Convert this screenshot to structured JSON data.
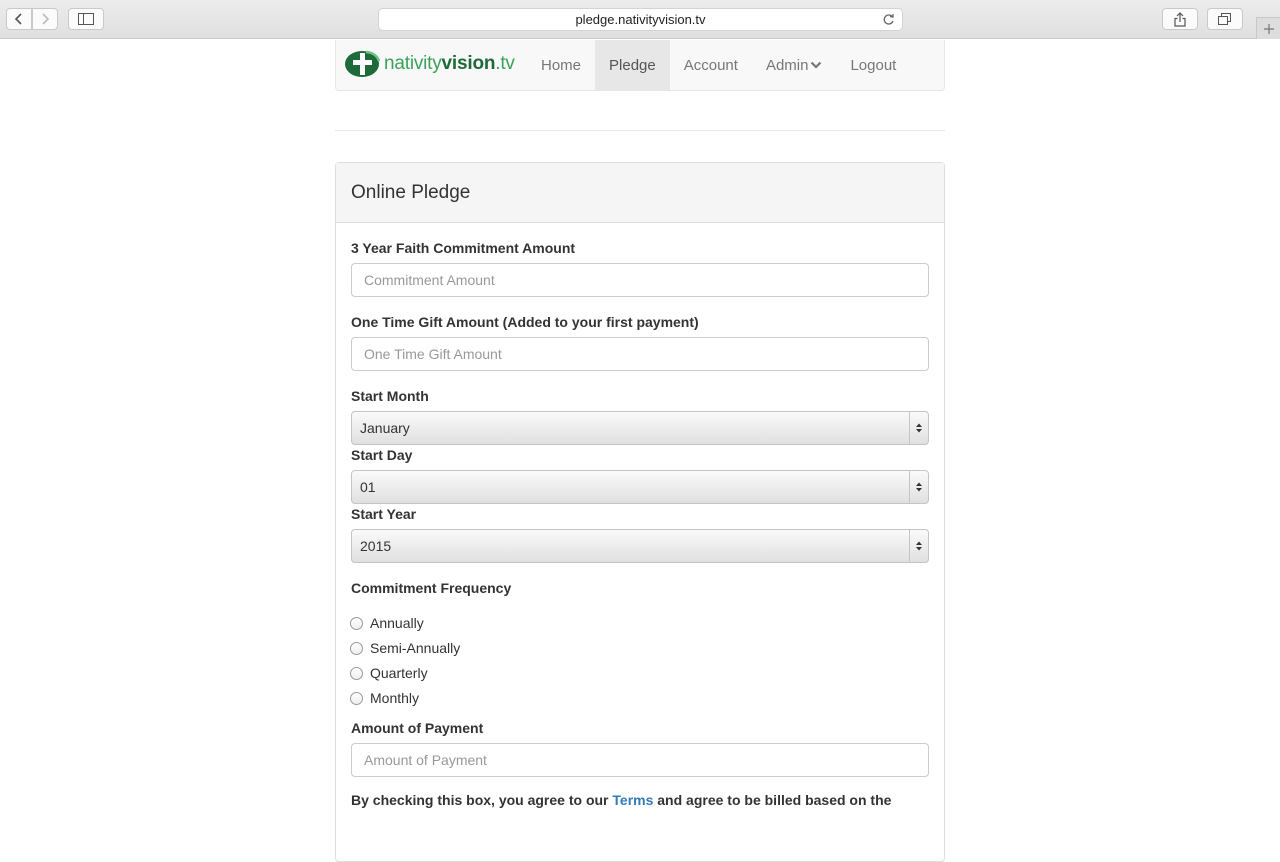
{
  "browser": {
    "url": "pledge.nativityvision.tv"
  },
  "brand": {
    "part1": "nativity",
    "part2": "vision",
    "part3": ".tv"
  },
  "nav": {
    "items": [
      {
        "label": "Home"
      },
      {
        "label": "Pledge",
        "active": true
      },
      {
        "label": "Account"
      },
      {
        "label": "Admin",
        "dropdown": true
      },
      {
        "label": "Logout"
      }
    ]
  },
  "panel": {
    "title": "Online Pledge"
  },
  "form": {
    "commitment": {
      "label": "3 Year Faith Commitment Amount",
      "placeholder": "Commitment Amount"
    },
    "gift": {
      "label": "One Time Gift Amount (Added to your first payment)",
      "placeholder": "One Time Gift Amount"
    },
    "start_month": {
      "label": "Start Month",
      "value": "January"
    },
    "start_day": {
      "label": "Start Day",
      "value": "01"
    },
    "start_year": {
      "label": "Start Year",
      "value": "2015"
    },
    "frequency": {
      "label": "Commitment Frequency",
      "options": [
        "Annually",
        "Semi-Annually",
        "Quarterly",
        "Monthly"
      ]
    },
    "payment": {
      "label": "Amount of Payment",
      "placeholder": "Amount of Payment"
    },
    "terms": {
      "before": "By checking this box, you agree to our ",
      "link": "Terms",
      "after": " and agree to be billed based on the"
    }
  },
  "colors": {
    "brand_light": "#3aa35a",
    "brand_dark": "#1f6a3a",
    "link": "#337ab7"
  }
}
